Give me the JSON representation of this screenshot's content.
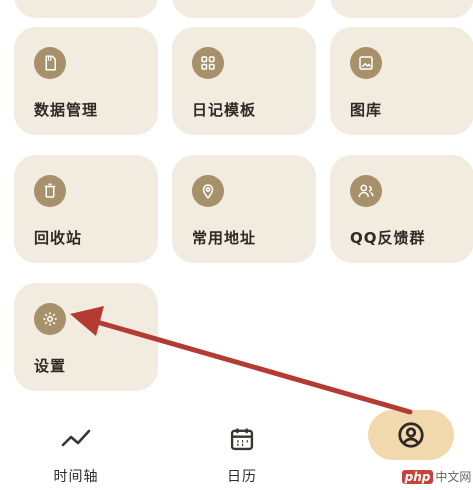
{
  "colors": {
    "card_bg": "#f2ebe0",
    "icon_bg": "#a6916b",
    "accent_pill": "#f1d9ad",
    "annotation_arrow": "#b33b33"
  },
  "grid": {
    "items": [
      {
        "label": "数据管理",
        "icon": "document-icon"
      },
      {
        "label": "日记模板",
        "icon": "grid-icon"
      },
      {
        "label": "图库",
        "icon": "image-icon"
      },
      {
        "label": "回收站",
        "icon": "trash-icon"
      },
      {
        "label": "常用地址",
        "icon": "location-pin-icon"
      },
      {
        "label": "QQ反馈群",
        "icon": "group-icon"
      },
      {
        "label": "设置",
        "icon": "gear-icon"
      }
    ]
  },
  "tabbar": {
    "tabs": [
      {
        "label": "时间轴",
        "icon": "trend-line-icon"
      },
      {
        "label": "日历",
        "icon": "calendar-icon"
      },
      {
        "label": "",
        "icon": "profile-icon",
        "active": true
      }
    ]
  },
  "watermark": {
    "badge": "php",
    "text": "中文网"
  }
}
